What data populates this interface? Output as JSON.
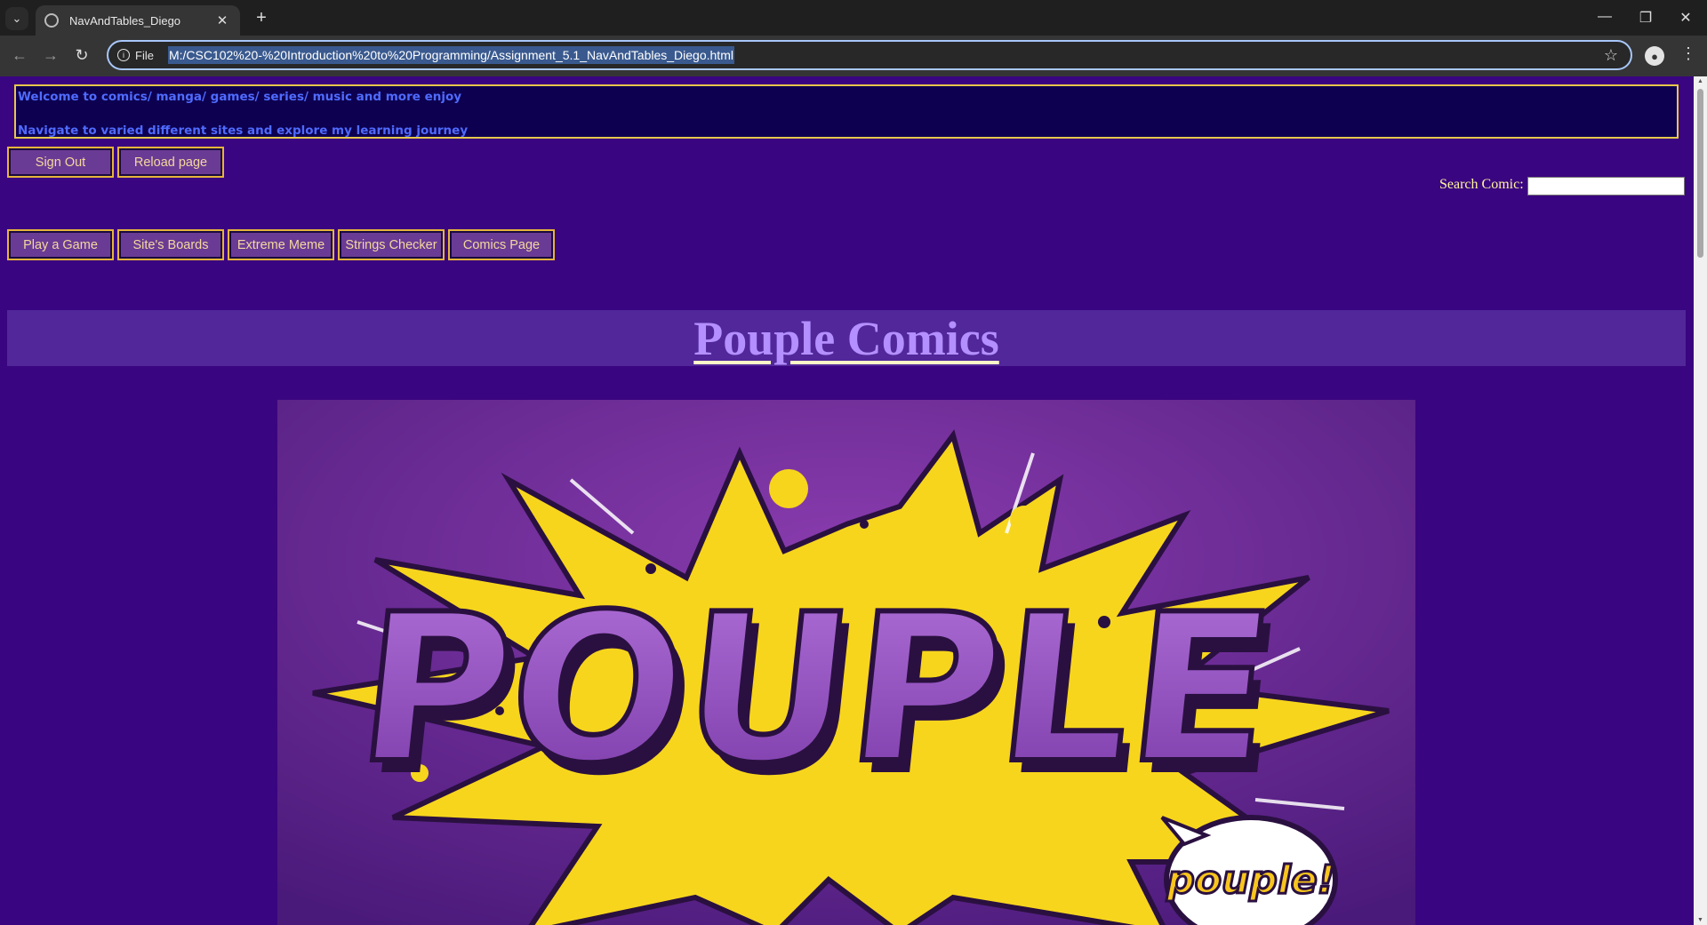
{
  "browser": {
    "tab_title": "NavAndTables_Diego",
    "site_chip": "File",
    "url": "M:/CSC102%20-%20Introduction%20to%20Programming/Assignment_5.1_NavAndTables_Diego.html"
  },
  "banner": {
    "line1": "Welcome to comics/ manga/ games/ series/ music and more enjoy",
    "line2": "Navigate to varied different sites and explore my learning journey"
  },
  "account_buttons": {
    "sign_out": "Sign Out",
    "reload": "Reload page"
  },
  "search": {
    "label": "Search Comic:",
    "value": ""
  },
  "nav": [
    {
      "label": "Play a Game"
    },
    {
      "label": "Site's Boards"
    },
    {
      "label": "Extreme Meme"
    },
    {
      "label": "Strings Checker"
    },
    {
      "label": "Comics Page"
    }
  ],
  "page_title": "Pouple Comics",
  "hero": {
    "headline": "POUPLE",
    "bubble_text": "pouple!"
  },
  "colors": {
    "page_bg": "#3a0580",
    "button_bg": "#6a3b94",
    "button_border": "#e6b43c",
    "title_link": "#b48fff",
    "starburst": "#f7d51d"
  }
}
